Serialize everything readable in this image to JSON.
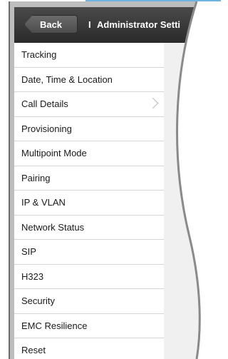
{
  "header": {
    "back_label": "Back",
    "separator": "I",
    "title": "Administrator Setti"
  },
  "menu": {
    "items": [
      {
        "label": "Tracking"
      },
      {
        "label": "Date, Time & Location"
      },
      {
        "label": "Call Details",
        "icon": "chevron-right-icon"
      },
      {
        "label": "Provisioning"
      },
      {
        "label": "Multipoint Mode"
      },
      {
        "label": "Pairing"
      },
      {
        "label": "IP & VLAN"
      },
      {
        "label": "Network Status"
      },
      {
        "label": "SIP"
      },
      {
        "label": "H323"
      },
      {
        "label": "Security"
      },
      {
        "label": "EMC Resilience"
      },
      {
        "label": "Reset"
      }
    ]
  },
  "colors": {
    "header_bg": "#2a2a2a",
    "back_button_bg": "#5a5a5a",
    "menu_bg": "#ffffff",
    "panel_bg": "#f0f0f0",
    "divider": "#d6d6d6"
  }
}
